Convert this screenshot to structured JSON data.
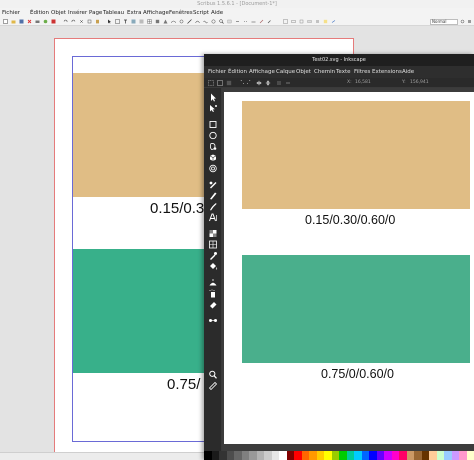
{
  "scribus": {
    "title": "Scribus 1.5.6.1 - [Document-1*]",
    "menu": [
      "Fichier",
      "Édition",
      "Objet",
      "Insérer",
      "Page",
      "Tableau",
      "Extra",
      "Affichage",
      "Fenêtres",
      "Script",
      "Aide"
    ],
    "mode_select": "Normal",
    "labels": {
      "top": "0.15/0.3",
      "bottom": "0.75/"
    },
    "colors": {
      "top_rect": "#e0bd85",
      "bottom_rect": "#38b08a",
      "page_border": "#e57b7b",
      "margin_border": "#6a6ad6"
    }
  },
  "inkscape": {
    "title": "Test02.svg - Inkscape",
    "menu": [
      "Fichier",
      "Édition",
      "Affichage",
      "Calque",
      "Objet",
      "Chemin",
      "Texte",
      "Filtres",
      "Extensions",
      "Aide"
    ],
    "ctrl": {
      "x_label": "X:",
      "x_value": "16,581",
      "y_label": "Y:",
      "y_value": "156,941"
    },
    "labels": {
      "top": "0.15/0.30/0.60/0",
      "bottom": "0.75/0/0.60/0"
    },
    "colors": {
      "top_rect": "#e0bd85",
      "bottom_rect": "#4aaf8c"
    },
    "tools": [
      "selector-icon",
      "node-icon",
      "rect-icon",
      "circle-icon",
      "star-icon",
      "3dbox-icon",
      "spiral-icon",
      "pencil-icon",
      "pen-icon",
      "calligraphy-icon",
      "text-icon",
      "gradient-icon",
      "mesh-icon",
      "dropper-icon",
      "paint-bucket-icon",
      "tweak-icon",
      "spray-icon",
      "eraser-icon",
      "connector-icon",
      "zoom-icon",
      "measure-icon"
    ],
    "palette": [
      "#000000",
      "#1a1a1a",
      "#333333",
      "#4d4d4d",
      "#666666",
      "#808080",
      "#999999",
      "#b3b3b3",
      "#cccccc",
      "#e6e6e6",
      "#ffffff",
      "#800000",
      "#ff0000",
      "#ff6600",
      "#ff9900",
      "#ffcc00",
      "#ffff00",
      "#99cc00",
      "#00cc00",
      "#00cc99",
      "#00ccff",
      "#0066ff",
      "#0000ff",
      "#6600ff",
      "#cc00ff",
      "#ff00cc",
      "#ff0066",
      "#cc9966",
      "#996633",
      "#663300",
      "#ffcc99",
      "#ccffcc",
      "#99ccff",
      "#cc99ff",
      "#ff99cc",
      "#ffffcc"
    ]
  }
}
